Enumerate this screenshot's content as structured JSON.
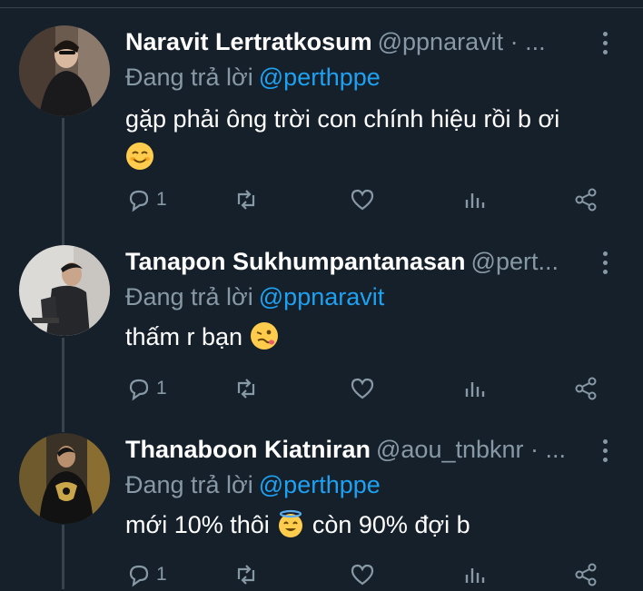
{
  "reply_prefix": "Đang trả lời",
  "tweets": [
    {
      "name": "Naravit Lertratkosum",
      "handle": "@ppnaravit · ...",
      "reply_to": "@perthppe",
      "text": "gặp phải ông trời con chính hiệu rồi b ơi",
      "emoji": "smiling-face-emoji",
      "reply_count": "1"
    },
    {
      "name": "Tanapon Sukhumpantanasan",
      "handle": "@pert...",
      "reply_to": "@ppnaravit",
      "text": "thấm r bạn",
      "emoji": "woozy-face-emoji",
      "reply_count": "1"
    },
    {
      "name": "Thanaboon Kiatniran",
      "handle": "@aou_tnbknr · ...",
      "reply_to": "@perthppe",
      "text_before": "mới 10% thôi",
      "emoji": "halo-face-emoji",
      "text_after": "còn 90% đợi b",
      "reply_count": "1"
    }
  ],
  "colors": {
    "background": "#15202b",
    "secondary_text": "#8899a6",
    "link": "#1da1f2",
    "divider": "#38444d"
  },
  "icons": [
    "reply-icon",
    "retweet-icon",
    "like-icon",
    "analytics-icon",
    "share-icon",
    "more-icon"
  ]
}
